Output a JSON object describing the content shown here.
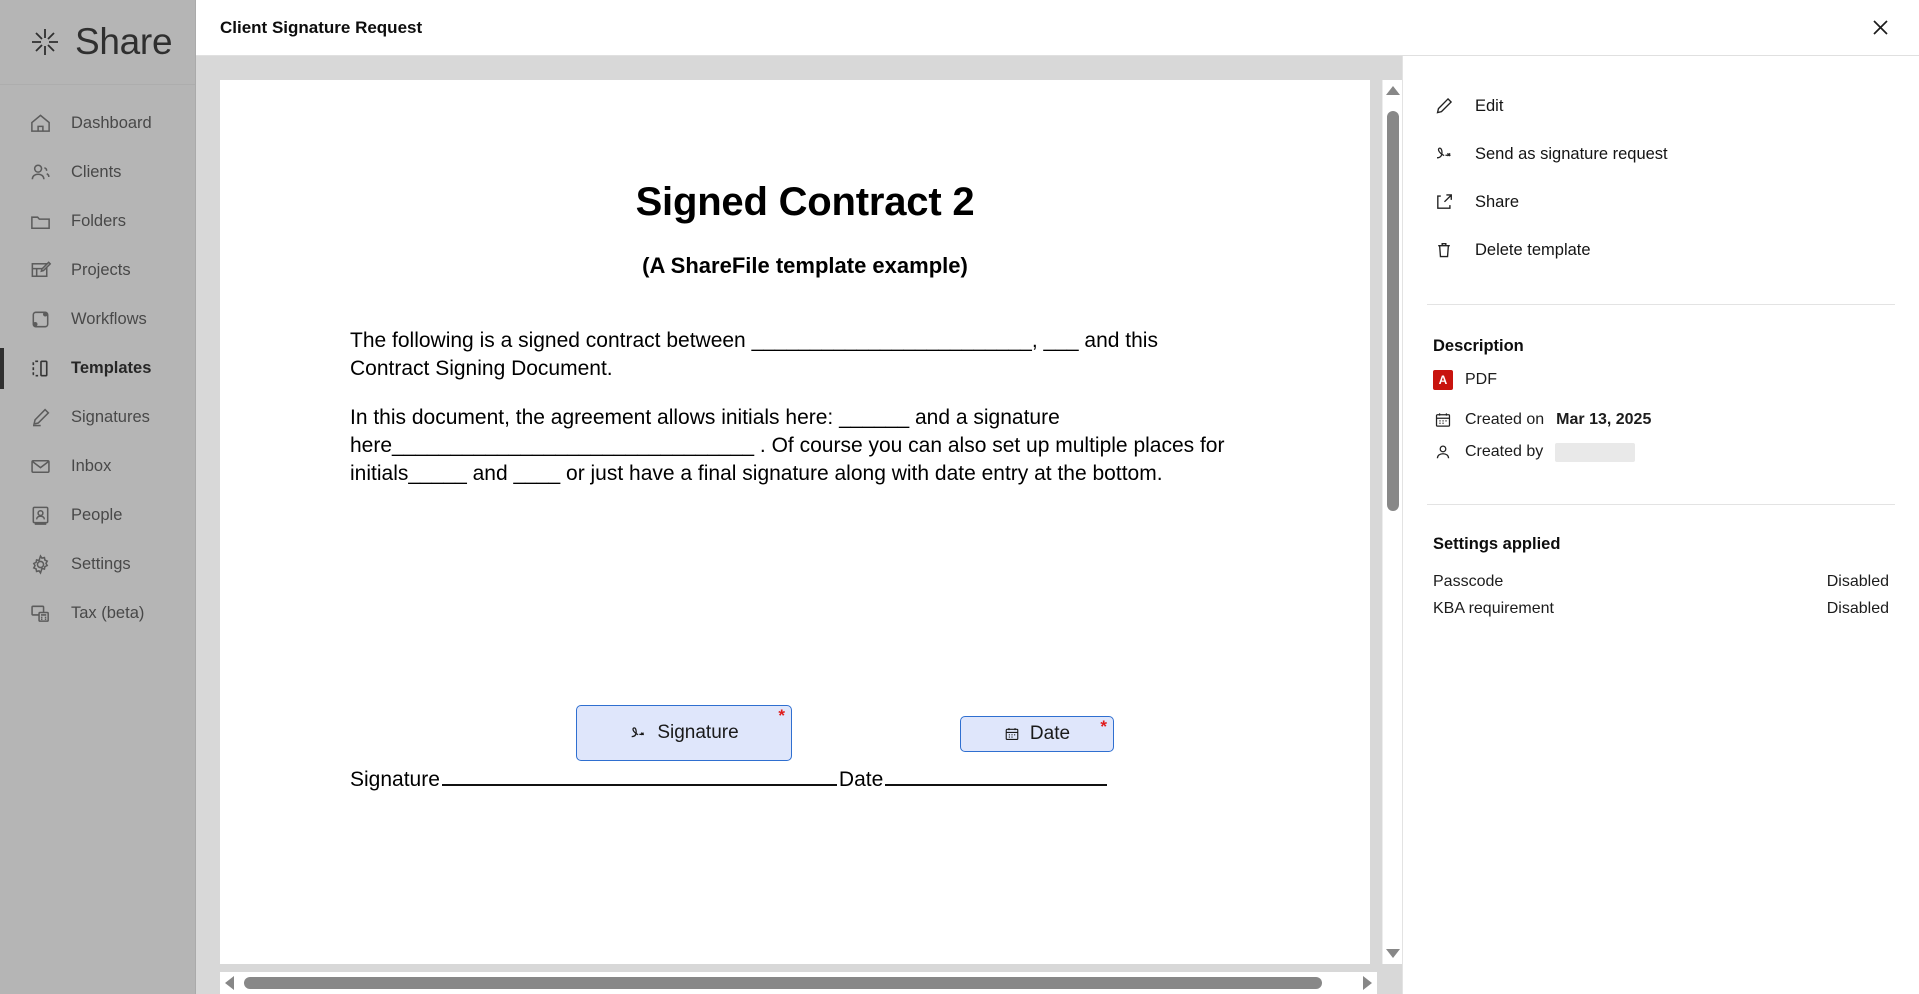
{
  "app": {
    "brand": "Share",
    "brand_icon": "sharefile-logo-icon",
    "sidebar": {
      "items": [
        {
          "label": "Dashboard",
          "icon": "home-icon",
          "active": false
        },
        {
          "label": "Clients",
          "icon": "people-icon",
          "active": false
        },
        {
          "label": "Folders",
          "icon": "folder-icon",
          "active": false
        },
        {
          "label": "Projects",
          "icon": "projects-icon",
          "active": false
        },
        {
          "label": "Workflows",
          "icon": "workflows-icon",
          "active": false
        },
        {
          "label": "Templates",
          "icon": "template-icon",
          "active": true
        },
        {
          "label": "Signatures",
          "icon": "pen-icon",
          "active": false
        },
        {
          "label": "Inbox",
          "icon": "envelope-icon",
          "active": false
        },
        {
          "label": "People",
          "icon": "contact-icon",
          "active": false
        },
        {
          "label": "Settings",
          "icon": "gear-icon",
          "active": false
        },
        {
          "label": "Tax (beta)",
          "icon": "tax-icon",
          "active": false
        }
      ]
    }
  },
  "modal": {
    "title": "Client Signature Request",
    "close_icon": "close-icon"
  },
  "document": {
    "title": "Signed Contract 2",
    "subtitle": "(A ShareFile template example)",
    "paragraphs": [
      "The following is a signed contract between ________________________, ___ and this Contract Signing Document.",
      "In this document, the agreement allows initials here: ______ and a signature here_______________________________ . Of course you can also set up multiple places for initials_____ and ____ or just have a final signature along with date entry at the bottom."
    ],
    "signature_label": "Signature",
    "date_label": "Date",
    "fields": [
      {
        "name": "signature-field",
        "label": "Signature",
        "icon": "signature-icon",
        "required": true
      },
      {
        "name": "date-field",
        "label": "Date",
        "icon": "calendar-icon",
        "required": true
      }
    ],
    "required_marker": "*"
  },
  "panel": {
    "actions": [
      {
        "label": "Edit",
        "icon": "pencil-icon"
      },
      {
        "label": "Send as signature request",
        "icon": "signature-icon"
      },
      {
        "label": "Share",
        "icon": "share-icon"
      },
      {
        "label": "Delete template",
        "icon": "trash-icon"
      }
    ],
    "description": {
      "heading": "Description",
      "file_type": "PDF",
      "file_type_icon": "pdf-icon",
      "created_on_label": "Created on",
      "created_on_value": "Mar 13, 2025",
      "created_on_icon": "calendar-icon",
      "created_by_label": "Created by",
      "created_by_value": "",
      "created_by_icon": "person-icon"
    },
    "settings": {
      "heading": "Settings applied",
      "rows": [
        {
          "label": "Passcode",
          "value": "Disabled"
        },
        {
          "label": "KBA requirement",
          "value": "Disabled"
        }
      ]
    }
  },
  "colors": {
    "field_fill": "#dfe6fb",
    "field_border": "#2f6fd0",
    "required_red": "#e01b1b",
    "pdf_red": "#c8140e",
    "scrollbar": "#888888"
  }
}
